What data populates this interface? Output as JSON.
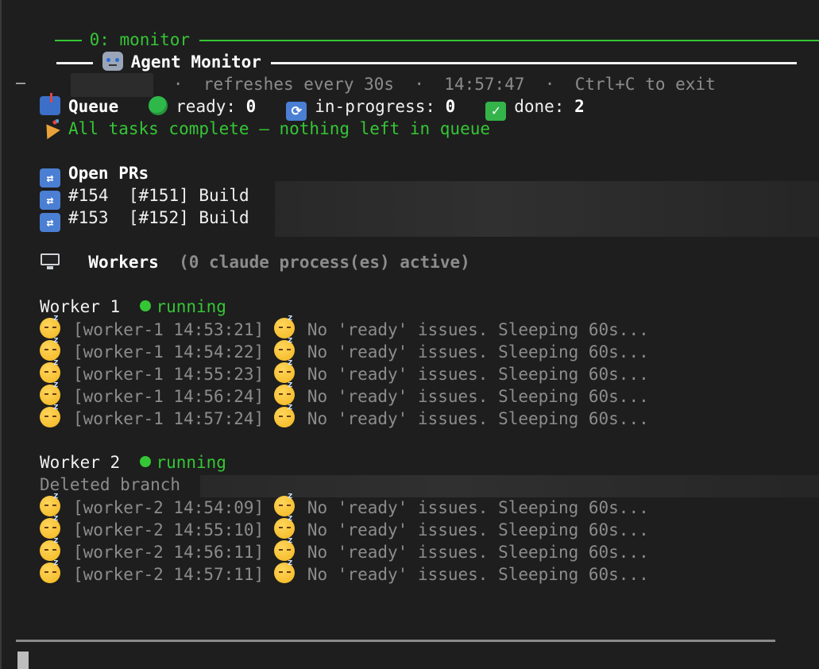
{
  "tab": {
    "label": "0: monitor"
  },
  "header": {
    "title": "Agent Monitor"
  },
  "subheader": {
    "sep": "·",
    "refresh": "refreshes every 30s",
    "time": "14:57:47",
    "exit_hint": "Ctrl+C to exit"
  },
  "queue": {
    "title": "Queue",
    "ready_label": "ready:",
    "ready": "0",
    "in_progress_label": "in-progress:",
    "in_progress": "0",
    "done_label": "done:",
    "done": "2",
    "message": "All tasks complete — nothing left in queue"
  },
  "prs": {
    "title": "Open PRs",
    "items": [
      {
        "number": "#154",
        "ref": "[#151]",
        "title": "Build"
      },
      {
        "number": "#153",
        "ref": "[#152]",
        "title": "Build"
      }
    ]
  },
  "workers_section": {
    "title": "Workers",
    "active": "(0 claude process(es) active)"
  },
  "workers": [
    {
      "name": "Worker 1",
      "status": "running",
      "logs": [
        {
          "tag": "[worker-1 14:53:21]",
          "msg": "No 'ready' issues. Sleeping 60s..."
        },
        {
          "tag": "[worker-1 14:54:22]",
          "msg": "No 'ready' issues. Sleeping 60s..."
        },
        {
          "tag": "[worker-1 14:55:23]",
          "msg": "No 'ready' issues. Sleeping 60s..."
        },
        {
          "tag": "[worker-1 14:56:24]",
          "msg": "No 'ready' issues. Sleeping 60s..."
        },
        {
          "tag": "[worker-1 14:57:24]",
          "msg": "No 'ready' issues. Sleeping 60s..."
        }
      ]
    },
    {
      "name": "Worker 2",
      "status": "running",
      "deleted": "Deleted branch",
      "logs": [
        {
          "tag": "[worker-2 14:54:09]",
          "msg": "No 'ready' issues. Sleeping 60s..."
        },
        {
          "tag": "[worker-2 14:55:10]",
          "msg": "No 'ready' issues. Sleeping 60s..."
        },
        {
          "tag": "[worker-2 14:56:11]",
          "msg": "No 'ready' issues. Sleeping 60s..."
        },
        {
          "tag": "[worker-2 14:57:11]",
          "msg": "No 'ready' issues. Sleeping 60s..."
        }
      ]
    }
  ],
  "icons": {
    "robot": "robot-icon",
    "mailbox": "mailbox-icon",
    "ready": "green-circle-icon",
    "refresh": "refresh-icon",
    "done": "check-icon",
    "party": "party-popper-icon",
    "pr": "shuffle-icon",
    "monitor": "desktop-monitor-icon",
    "sleep": "sleeping-face-icon"
  },
  "colors": {
    "background": "#1e1e1e",
    "accent_green": "#35c635",
    "dim_text": "#8c8c8c"
  }
}
